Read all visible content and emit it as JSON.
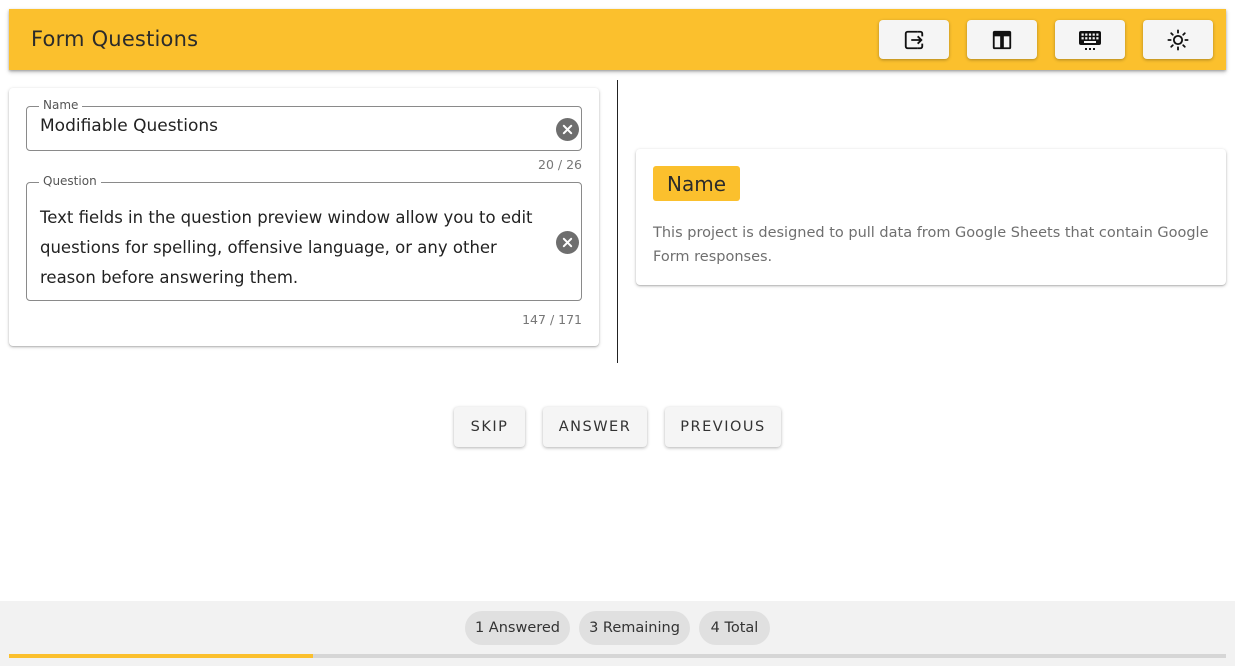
{
  "header": {
    "title": "Form Questions",
    "toolbar": [
      {
        "icon": "export-icon"
      },
      {
        "icon": "table-icon"
      },
      {
        "icon": "keyboard-icon"
      },
      {
        "icon": "brightness-icon"
      }
    ]
  },
  "editor": {
    "name_field": {
      "label": "Name",
      "value": "Modifiable Questions",
      "counter": "20 / 26"
    },
    "question_field": {
      "label": "Question",
      "value": "Text fields in the question preview window allow you to edit questions for spelling, offensive language, or any other reason before answering them.",
      "counter": "147 / 171"
    }
  },
  "preview": {
    "tag": "Name",
    "description": "This project is designed to pull data from Google Sheets that contain Google Form responses."
  },
  "actions": {
    "skip": "SKIP",
    "answer": "ANSWER",
    "previous": "PREVIOUS"
  },
  "footer": {
    "answered": "1 Answered",
    "remaining": "3 Remaining",
    "total": "4 Total",
    "progress_fraction": 0.25
  },
  "colors": {
    "accent": "#fbc02d"
  }
}
